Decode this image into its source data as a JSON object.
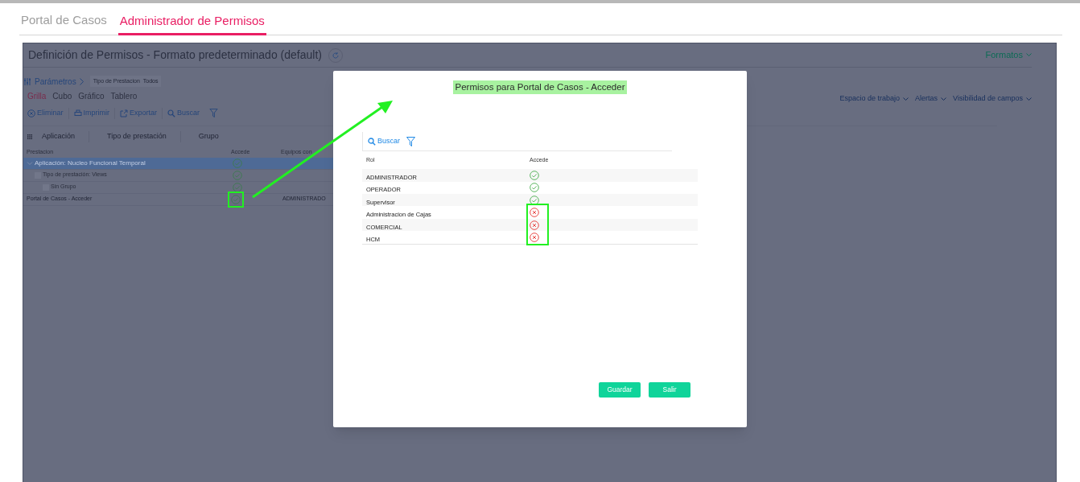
{
  "tabs": [
    {
      "label": "Portal de Casos",
      "selected": false
    },
    {
      "label": "Administrador de Permisos",
      "selected": true
    }
  ],
  "panel": {
    "title": "Definición de Permisos - Formato predeterminado (default)",
    "formats_menu": "Formatos",
    "parameters": "Parámetros",
    "param_chip": {
      "label": "Tipo de Prestacion",
      "value": "Todos"
    },
    "view_tabs": [
      {
        "label": "Grilla",
        "selected": true
      },
      {
        "label": "Cubo",
        "selected": false
      },
      {
        "label": "Gráfico",
        "selected": false
      },
      {
        "label": "Tablero",
        "selected": false
      }
    ],
    "toolbar": [
      {
        "kind": "delete",
        "label": "Eliminar"
      },
      {
        "kind": "print",
        "label": "Imprimir"
      },
      {
        "kind": "export",
        "label": "Exportar"
      },
      {
        "kind": "search",
        "label": "Buscar"
      },
      {
        "kind": "filter"
      }
    ],
    "menus": [
      "Espacio de trabajo",
      "Alertas",
      "Visibilidad de campos"
    ],
    "group_by": [
      "Aplicación",
      "Tipo de prestación",
      "Grupo"
    ],
    "columns": [
      "Prestacion",
      "Accede",
      "Equipos con"
    ],
    "rows": [
      {
        "kind": "group",
        "label": "Aplicación: Nucleo Funcional Temporal",
        "selected": true,
        "access": true,
        "expanded": true,
        "children": [
          {
            "kind": "group",
            "label": "Tipo de prestación: Views",
            "selected": false,
            "access": true,
            "expanded": true,
            "children": [
              {
                "kind": "group",
                "label": "Sin Grupo",
                "selected": false,
                "access": true,
                "expanded": true,
                "children": [
                  {
                    "kind": "item",
                    "label": "Portal de Casos - Acceder",
                    "selected": false,
                    "access": true,
                    "teams": "ADMINISTRADO",
                    "marked": true
                  }
                ]
              }
            ]
          }
        ]
      }
    ]
  },
  "modal": {
    "title": "Permisos para Portal de Casos - Acceder",
    "title_marked": true,
    "search": "Buscar",
    "columns": [
      "Rol",
      "Accede"
    ],
    "rows": [
      {
        "role": "ADMINISTRADOR",
        "access": true,
        "marked": false
      },
      {
        "role": "OPERADOR",
        "access": true,
        "marked": false
      },
      {
        "role": "Supervisor",
        "access": true,
        "marked": false
      },
      {
        "role": "Administracion de Cajas",
        "access": false,
        "marked": true
      },
      {
        "role": "COMERCIAL",
        "access": false,
        "marked": true
      },
      {
        "role": "HCM",
        "access": false,
        "marked": true
      }
    ],
    "buttons": [
      "Guardar",
      "Salir"
    ]
  }
}
